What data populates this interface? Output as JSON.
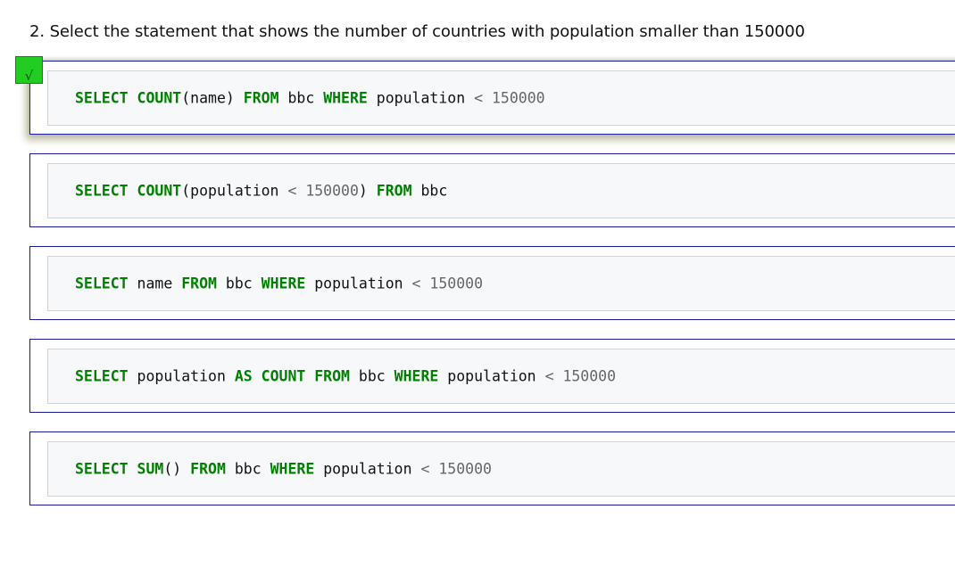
{
  "question": {
    "text": "2. Select the statement that shows the number of countries with population smaller than 150000"
  },
  "selected_index": 0,
  "check_mark": "√",
  "options": [
    {
      "tokens": [
        {
          "t": "SELECT",
          "c": "kw"
        },
        {
          "t": " "
        },
        {
          "t": "COUNT",
          "c": "kw"
        },
        {
          "t": "(name) "
        },
        {
          "t": "FROM",
          "c": "kw"
        },
        {
          "t": " bbc "
        },
        {
          "t": "WHERE",
          "c": "kw"
        },
        {
          "t": " population "
        },
        {
          "t": "<",
          "c": "op"
        },
        {
          "t": " "
        },
        {
          "t": "150000",
          "c": "num"
        }
      ]
    },
    {
      "tokens": [
        {
          "t": "SELECT",
          "c": "kw"
        },
        {
          "t": " "
        },
        {
          "t": "COUNT",
          "c": "kw"
        },
        {
          "t": "(population "
        },
        {
          "t": "<",
          "c": "op"
        },
        {
          "t": " "
        },
        {
          "t": "150000",
          "c": "num"
        },
        {
          "t": ") "
        },
        {
          "t": "FROM",
          "c": "kw"
        },
        {
          "t": " bbc"
        }
      ]
    },
    {
      "tokens": [
        {
          "t": "SELECT",
          "c": "kw"
        },
        {
          "t": " name "
        },
        {
          "t": "FROM",
          "c": "kw"
        },
        {
          "t": " bbc "
        },
        {
          "t": "WHERE",
          "c": "kw"
        },
        {
          "t": " population "
        },
        {
          "t": "<",
          "c": "op"
        },
        {
          "t": " "
        },
        {
          "t": "150000",
          "c": "num"
        }
      ]
    },
    {
      "tokens": [
        {
          "t": "SELECT",
          "c": "kw"
        },
        {
          "t": " population "
        },
        {
          "t": "AS",
          "c": "kw"
        },
        {
          "t": " "
        },
        {
          "t": "COUNT",
          "c": "kw"
        },
        {
          "t": " "
        },
        {
          "t": "FROM",
          "c": "kw"
        },
        {
          "t": " bbc "
        },
        {
          "t": "WHERE",
          "c": "kw"
        },
        {
          "t": " population "
        },
        {
          "t": "<",
          "c": "op"
        },
        {
          "t": " "
        },
        {
          "t": "150000",
          "c": "num"
        }
      ]
    },
    {
      "tokens": [
        {
          "t": "SELECT",
          "c": "kw"
        },
        {
          "t": " "
        },
        {
          "t": "SUM",
          "c": "kw"
        },
        {
          "t": "() "
        },
        {
          "t": "FROM",
          "c": "kw"
        },
        {
          "t": " bbc "
        },
        {
          "t": "WHERE",
          "c": "kw"
        },
        {
          "t": " population "
        },
        {
          "t": "<",
          "c": "op"
        },
        {
          "t": " "
        },
        {
          "t": "150000",
          "c": "num"
        }
      ]
    }
  ]
}
